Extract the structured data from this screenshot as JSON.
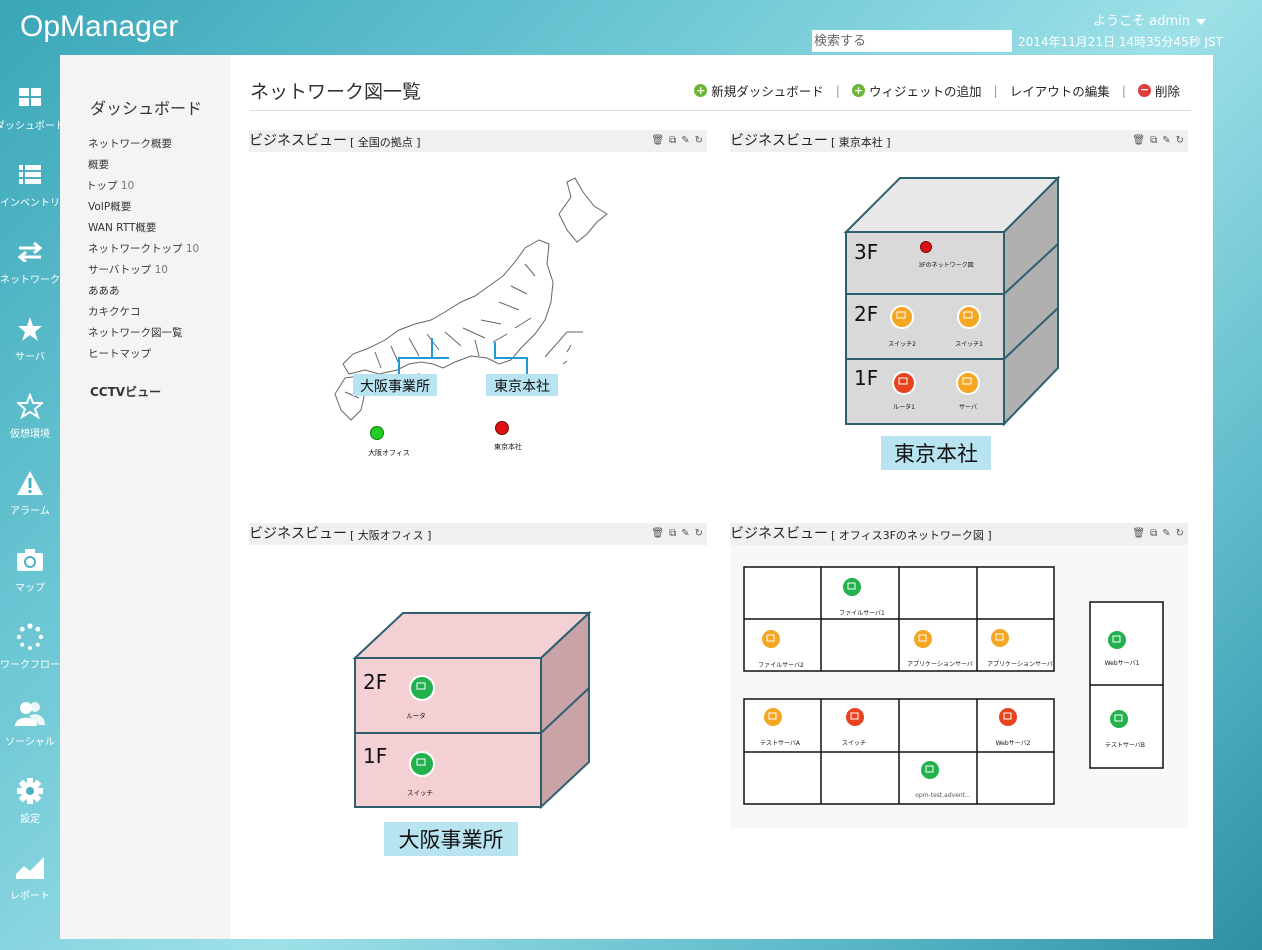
{
  "header": {
    "app_title": "OpManager",
    "welcome": "ようこそ admin",
    "search_placeholder": "検索する",
    "datetime": "2014年11月21日 14時35分45秒 JST"
  },
  "leftnav": [
    {
      "label": "ダッシュボード",
      "icon": "dashboard-icon"
    },
    {
      "label": "インベントリ",
      "icon": "inventory-icon"
    },
    {
      "label": "ネットワーク",
      "icon": "network-icon"
    },
    {
      "label": "サーバ",
      "icon": "star-icon"
    },
    {
      "label": "仮想環境",
      "icon": "star-outline-icon"
    },
    {
      "label": "アラーム",
      "icon": "alarm-icon"
    },
    {
      "label": "マップ",
      "icon": "camera-icon"
    },
    {
      "label": "ワークフロー",
      "icon": "workflow-icon"
    },
    {
      "label": "ソーシャル",
      "icon": "social-icon"
    },
    {
      "label": "設定",
      "icon": "gear-icon"
    },
    {
      "label": "レポート",
      "icon": "report-icon"
    }
  ],
  "subnav": {
    "title": "ダッシュボード",
    "items": [
      {
        "label": "ネットワーク概要",
        "count": ""
      },
      {
        "label": "概要",
        "count": ""
      },
      {
        "label": "トップ",
        "count": "10"
      },
      {
        "label": "VoIP概要",
        "count": ""
      },
      {
        "label": "WAN RTT概要",
        "count": ""
      },
      {
        "label": "ネットワークトップ",
        "count": "10"
      },
      {
        "label": "サーバトップ",
        "count": "10"
      },
      {
        "label": "あああ",
        "count": ""
      },
      {
        "label": "カキクケコ",
        "count": ""
      },
      {
        "label": "ネットワーク図一覧",
        "count": ""
      },
      {
        "label": "ヒートマップ",
        "count": ""
      }
    ],
    "cctv": "CCTVビュー"
  },
  "page": {
    "title": "ネットワーク図一覧",
    "actions": {
      "new_dashboard": "新規ダッシュボード",
      "add_widget": "ウィジェットの追加",
      "edit_layout": "レイアウトの編集",
      "delete": "削除"
    }
  },
  "widgets": {
    "w1": {
      "title": "ビジネスビュー",
      "subtitle": "[ 全国の拠点 ]",
      "labels": {
        "osaka": "大阪事業所",
        "tokyo": "東京本社"
      },
      "nodes": [
        {
          "label": "大阪オフィス",
          "status": "green"
        },
        {
          "label": "東京本社",
          "status": "red"
        }
      ]
    },
    "w2": {
      "title": "ビジネスビュー",
      "subtitle": "[ 東京本社 ]",
      "floors": {
        "f3": "3F",
        "f2": "2F",
        "f1": "1F"
      },
      "nodes": {
        "n3f": "3Fのネットワーク図",
        "sw2": "スイッチ2",
        "sw1": "スイッチ1",
        "router1": "ルータ1",
        "server": "サーバ"
      },
      "building_label": "東京本社"
    },
    "w3": {
      "title": "ビジネスビュー",
      "subtitle": "[ 大阪オフィス ]",
      "floors": {
        "f2": "2F",
        "f1": "1F"
      },
      "nodes": {
        "router": "ルータ",
        "switch": "スイッチ"
      },
      "building_label": "大阪事業所"
    },
    "w4": {
      "title": "ビジネスビュー",
      "subtitle": "[ オフィス3Fのネットワーク図 ]",
      "nodes": {
        "fs1": "ファイルサーバ1",
        "fs2": "ファイルサーバ2",
        "app1": "アプリケーションサーバ",
        "app2": "アプリケーションサーバ",
        "web1": "Webサーバ1",
        "testA": "テストサーバA",
        "sw": "スイッチ",
        "web2": "Webサーバ2",
        "opm": "opm-test.advent...",
        "testB": "テストサーバB"
      }
    }
  },
  "colors": {
    "green": "#22b14c",
    "orange": "#f5a623",
    "red": "#e8421f",
    "label_bg": "#b8e3f0"
  }
}
